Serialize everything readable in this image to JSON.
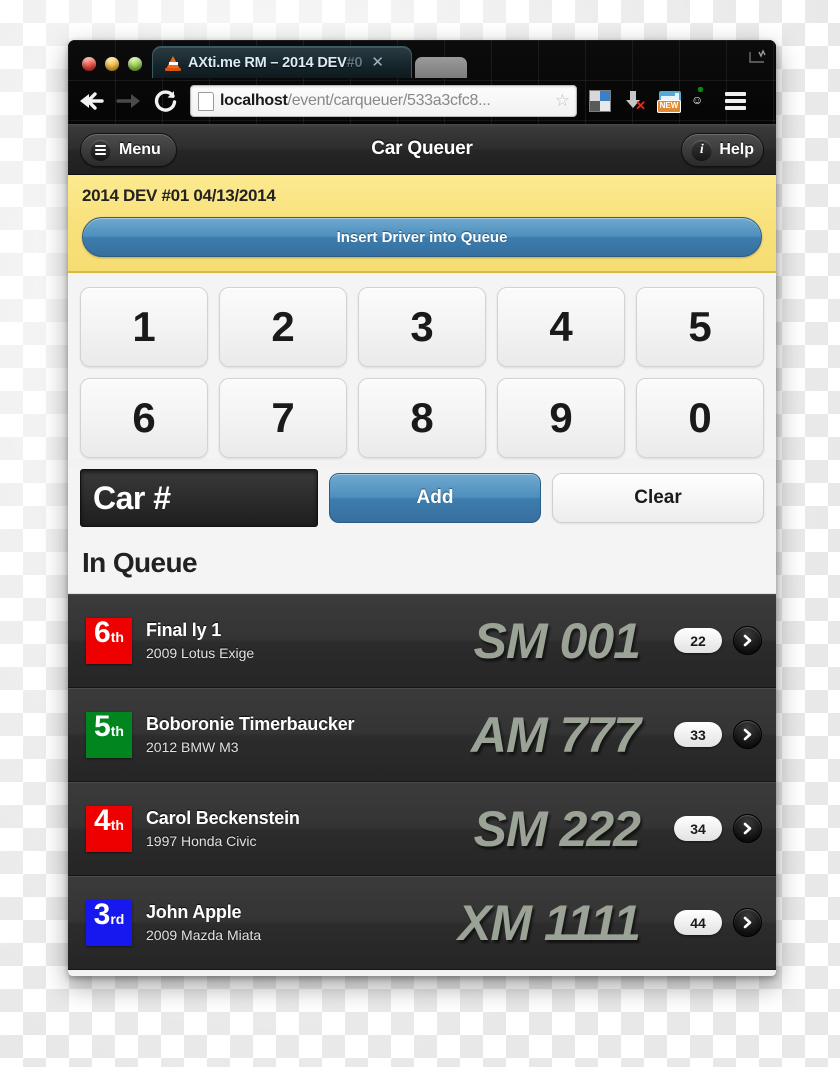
{
  "browser": {
    "traffic_lights": [
      "close",
      "minimize",
      "zoom"
    ],
    "tab": {
      "favicon": "traffic-cone-icon",
      "title": "AXti.me RM – 2014 DEV",
      "title_dim": "#0",
      "close_glyph": "✕"
    },
    "nav": {
      "back": "←",
      "forward": "→",
      "reload": "⟳"
    },
    "url": {
      "host": "localhost",
      "path": "/event/carqueuer/533a3cfc8...",
      "bookmark_glyph": "☆"
    },
    "extensions": [
      {
        "name": "grid-icon"
      },
      {
        "name": "download-arrow-icon",
        "badge": "✕"
      },
      {
        "name": "new-window-icon",
        "badge": "NEW"
      },
      {
        "name": "green-circle-icon",
        "glyph": "☺"
      },
      {
        "name": "browser-menu-icon"
      }
    ]
  },
  "app": {
    "header": {
      "menu_label": "Menu",
      "title": "Car Queuer",
      "help_label": "Help",
      "help_icon_glyph": "i"
    },
    "banner": {
      "event_title": "2014 DEV #01 04/13/2014",
      "insert_button": "Insert Driver into Queue",
      "bg_color": "#f8e07a"
    },
    "keypad": {
      "row1": [
        "1",
        "2",
        "3",
        "4",
        "5"
      ],
      "row2": [
        "6",
        "7",
        "8",
        "9",
        "0"
      ]
    },
    "entry": {
      "car_field_value": "Car #",
      "car_field_placeholder": "Car #",
      "add_label": "Add",
      "clear_label": "Clear"
    },
    "queue": {
      "heading": "In Queue",
      "rows": [
        {
          "rank_number": "6",
          "rank_ordinal": "th",
          "rank_color": "#ef0000",
          "name": "Final ly 1",
          "car": "2009 Lotus Exige",
          "plate": "SM 001",
          "count": "22",
          "chevron": "disclosure-icon"
        },
        {
          "rank_number": "5",
          "rank_ordinal": "th",
          "rank_color": "#00851f",
          "name": "Boboronie Timerbaucker",
          "car": "2012 BMW M3",
          "plate": "AM 777",
          "count": "33",
          "chevron": "disclosure-icon"
        },
        {
          "rank_number": "4",
          "rank_ordinal": "th",
          "rank_color": "#ef0000",
          "name": "Carol Beckenstein",
          "car": "1997 Honda Civic",
          "plate": "SM 222",
          "count": "34",
          "chevron": "disclosure-icon"
        },
        {
          "rank_number": "3",
          "rank_ordinal": "rd",
          "rank_color": "#1717ef",
          "name": "John Apple",
          "car": "2009 Mazda Miata",
          "plate": "XM 1111",
          "count": "44",
          "chevron": "disclosure-icon"
        }
      ]
    }
  }
}
